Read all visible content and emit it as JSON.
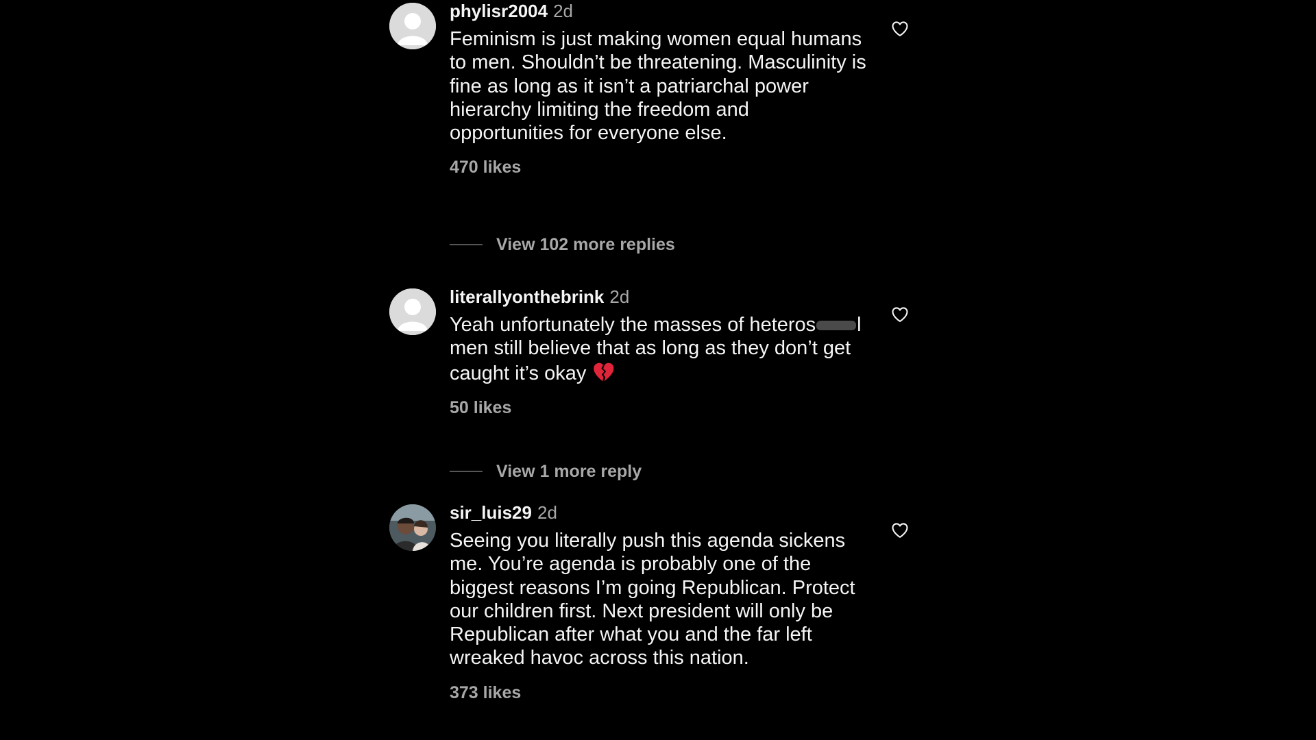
{
  "comments": [
    {
      "username": "phylisr2004",
      "time": "2d",
      "text": "Feminism is just making women equal humans to men. Shouldn’t be threatening. Masculinity is fine as long as it isn’t a patriarchal power hierarchy limiting the freedom and opportunities for everyone else.",
      "likes": "470 likes",
      "replies_label": "View 102 more replies",
      "avatar_icon": "default-avatar-icon",
      "like_icon": "heart-outline-icon"
    },
    {
      "username": "literallyonthebrink",
      "time": "2d",
      "text_before_redaction": "Yeah unfortunately the masses of heteros",
      "text_after_redaction": "l men still believe that as long as they don’t get caught it’s okay",
      "emoji": "broken-heart-emoji",
      "likes": "50 likes",
      "replies_label": "View 1 more reply",
      "avatar_icon": "default-avatar-icon",
      "like_icon": "heart-outline-icon"
    },
    {
      "username": "sir_luis29",
      "time": "2d",
      "text": "Seeing you literally push this agenda sickens me. You’re agenda is probably one of the biggest reasons I’m going Republican. Protect our children first. Next president will only be Republican after what you and the far left wreaked havoc across this nation.",
      "likes": "373 likes",
      "avatar_icon": "profile-photo",
      "like_icon": "heart-outline-icon"
    }
  ],
  "colors": {
    "background": "#000000",
    "primary_text": "#f5f5f5",
    "secondary_text": "#a8a8a8",
    "broken_heart": "#e0243a"
  }
}
